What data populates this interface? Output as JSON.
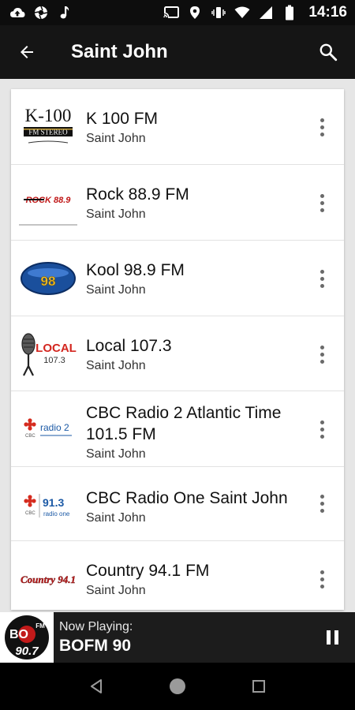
{
  "status_bar": {
    "time": "14:16",
    "left_icons": [
      "cloud-upload-icon",
      "aperture-icon",
      "music-note-icon"
    ],
    "right_icons": [
      "cast-icon",
      "location-icon",
      "vibrate-icon",
      "wifi-icon",
      "signal-icon",
      "battery-icon"
    ]
  },
  "app_bar": {
    "title": "Saint John",
    "back_icon": "arrow-back-icon",
    "search_icon": "search-icon"
  },
  "stations": [
    {
      "name": "K 100 FM",
      "city": "Saint John",
      "logo_text": "K-100",
      "logo_sub": "FM STEREO"
    },
    {
      "name": "Rock 88.9 FM",
      "city": "Saint John",
      "logo_text": "ROCK 88.9"
    },
    {
      "name": "Kool 98.9 FM",
      "city": "Saint John",
      "logo_text": "98"
    },
    {
      "name": "Local 107.3",
      "city": "Saint John",
      "logo_text": "LOCAL",
      "logo_sub": "107.3"
    },
    {
      "name": "CBC Radio 2 Atlantic Time 101.5 FM",
      "city": "Saint John",
      "logo_text": "radio 2"
    },
    {
      "name": "CBC Radio One Saint John",
      "city": "Saint John",
      "logo_text": "91.3",
      "logo_sub": "radio one"
    },
    {
      "name": "Country 94.1 FM",
      "city": "Saint John",
      "logo_text": "Country 94.1"
    }
  ],
  "now_playing": {
    "label": "Now Playing:",
    "station": "BOFM 90",
    "logo_text": "90.7",
    "logo_top": "BO",
    "logo_fm": "FM"
  },
  "nav_bar": {
    "icons": [
      "back-triangle-icon",
      "home-circle-icon",
      "recents-square-icon"
    ]
  },
  "colors": {
    "app_bar": "#151515",
    "status_bar": "#0d0d0d",
    "list_background": "#e6e6e6",
    "now_playing_bar": "#1c1c1c",
    "cbc_red": "#d52b1e"
  }
}
